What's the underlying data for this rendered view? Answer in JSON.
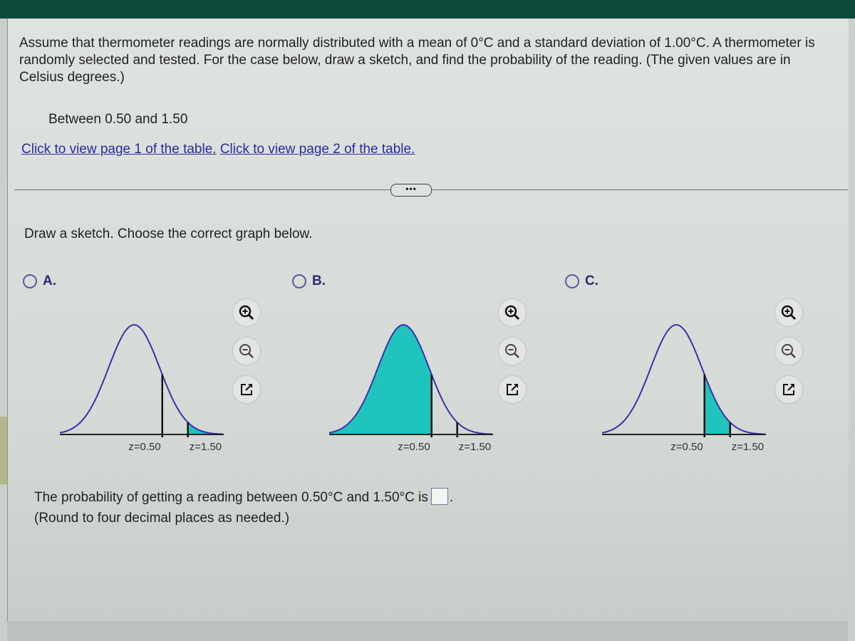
{
  "question": {
    "text": "Assume that thermometer readings are normally distributed with a mean of 0°C and a standard deviation of 1.00°C. A thermometer is randomly selected and tested. For the case below, draw a sketch, and find the probability of the reading. (The given values are in Celsius degrees.)",
    "case": "Between 0.50 and 1.50",
    "mean": 0,
    "std_dev": 1.0
  },
  "links": {
    "table_page1": "Click to view page 1 of the table.",
    "table_page2": "Click to view page 2 of the table."
  },
  "divider": {
    "more_label": "•••"
  },
  "instruction": "Draw a sketch. Choose the correct graph below.",
  "options": [
    {
      "letter": "A.",
      "selected": false,
      "shaded_region": "z > 1.50",
      "labels": [
        "z=0.50",
        "z=1.50"
      ],
      "shade_from": 1.5,
      "shade_to": 3.2
    },
    {
      "letter": "B.",
      "selected": false,
      "shaded_region": "z < 0.50",
      "labels": [
        "z=0.50",
        "z=1.50"
      ],
      "shade_from": -3.2,
      "shade_to": 0.5
    },
    {
      "letter": "C.",
      "selected": false,
      "shaded_region": "0.50 < z < 1.50",
      "labels": [
        "z=0.50",
        "z=1.50"
      ],
      "shade_from": 0.5,
      "shade_to": 1.5
    }
  ],
  "tools": {
    "zoom_in": "zoom-in-icon",
    "zoom_out": "zoom-out-icon",
    "popout": "popout-icon"
  },
  "colors": {
    "curve": "#3b2fae",
    "shade": "#1fc4bd",
    "link": "#2a2aa0",
    "header": "#0b4a3a"
  },
  "answer": {
    "prefix": "The probability of getting a reading between 0.50°C and 1.50°C is",
    "suffix": ".",
    "value": "",
    "note": "(Round to four decimal places as needed.)"
  }
}
